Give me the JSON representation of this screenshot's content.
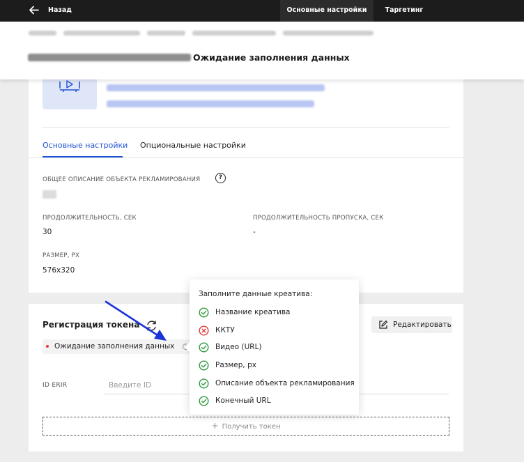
{
  "topbar": {
    "back_label": "Назад",
    "tabs": [
      "Основные настройки",
      "Таргетинг"
    ]
  },
  "header": {
    "title": "Ожидание заполнения данных"
  },
  "main": {
    "tabs": [
      "Основные настройки",
      "Опциональные настройки"
    ],
    "fields": {
      "description_label": "ОБЩЕЕ ОПИСАНИЕ ОБЪЕКТА РЕКЛАМИРОВАНИЯ",
      "duration_label": "ПРОДОЛЖИТЕЛЬНОСТЬ, СЕК",
      "duration_value": "30",
      "skip_label": "ПРОДОЛЖИТЕЛЬНОСТЬ ПРОПУСКА, СЕК",
      "skip_value": "-",
      "size_label": "РАЗМЕР, РХ",
      "size_value": "576x320"
    }
  },
  "token": {
    "title": "Регистрация токена",
    "status": "Ожидание заполнения данных",
    "edit_label": "Редактировать",
    "id_label": "ID ERIR",
    "id_placeholder": "Введите ID",
    "get_token_label": "Получить токен"
  },
  "popover": {
    "title": "Заполните данные креатива:",
    "items": [
      {
        "label": "Название креатива",
        "ok": true
      },
      {
        "label": "ККТУ",
        "ok": false
      },
      {
        "label": "Видео (URL)",
        "ok": true
      },
      {
        "label": "Размер, px",
        "ok": true
      },
      {
        "label": "Описание объекта рекламирования",
        "ok": true
      },
      {
        "label": "Конечный URL",
        "ok": true
      }
    ]
  },
  "colors": {
    "accent": "#2152d6",
    "topbar": "#1c1c1c",
    "success": "#2e9b3e",
    "error": "#e53935",
    "annotation_arrow": "#1a33d9"
  }
}
